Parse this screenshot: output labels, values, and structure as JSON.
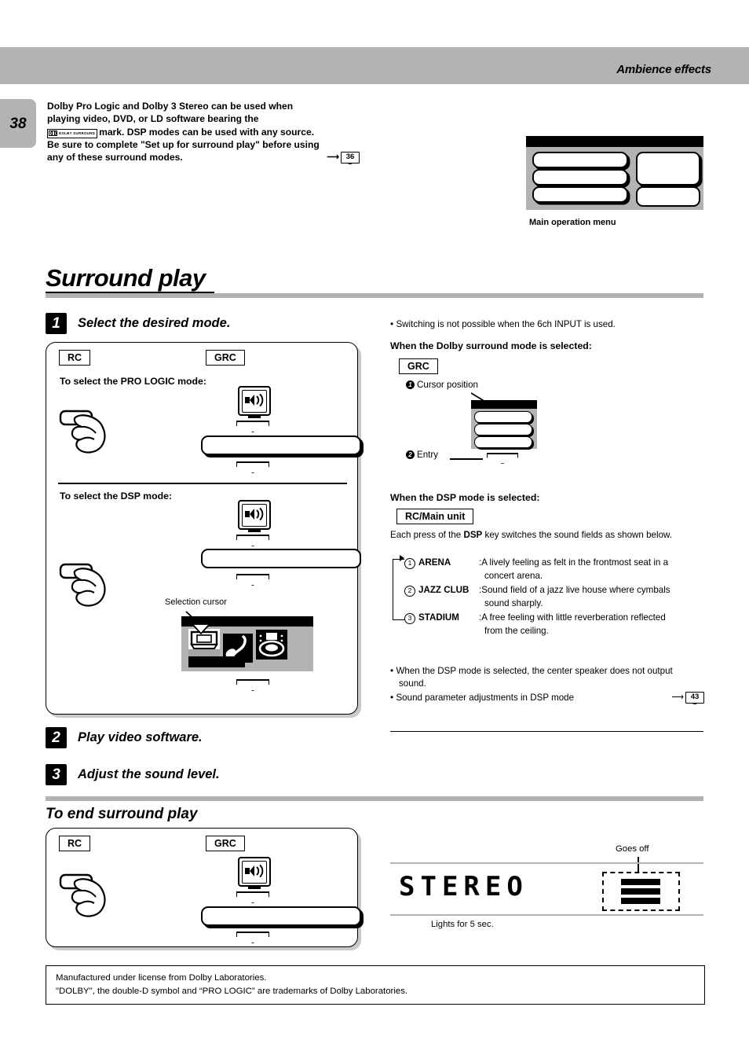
{
  "header": {
    "title": "Ambience effects",
    "page_number": "38"
  },
  "intro": {
    "line1": "Dolby Pro Logic and Dolby 3 Stereo can be used when",
    "line2": "playing video, DVD, or LD software bearing the",
    "line3_before_mark": "",
    "dolby_mark_text": "DOLBY SURROUND",
    "line3_after_mark": "mark. DSP modes can be used with any source.",
    "line4": "Be sure to complete \"Set up for surround play\" before using",
    "line5": "any of these surround modes.",
    "page_ref": "36"
  },
  "menu_illustration": {
    "caption": "Main operation menu"
  },
  "section": {
    "title": "Surround play",
    "end_title": "To end surround play"
  },
  "steps": [
    {
      "num": "1",
      "label": "Select the desired mode."
    },
    {
      "num": "2",
      "label": "Play video software."
    },
    {
      "num": "3",
      "label": "Adjust the sound level."
    }
  ],
  "panel1": {
    "tag_rc": "RC",
    "tag_grc": "GRC",
    "heading_prologic": "To select the PRO LOGIC mode:",
    "heading_dsp": "To select the DSP mode:",
    "selection_cursor_label": "Selection cursor"
  },
  "panel2": {
    "tag_rc": "RC",
    "tag_grc": "GRC"
  },
  "right_column": {
    "note_switching": "Switching is not possible when the 6ch INPUT is used.",
    "dolby_heading": "When the Dolby surround mode is selected:",
    "tag_grc": "GRC",
    "cursor_position": "Cursor position",
    "cursor_position_num": "1",
    "entry": "Entry",
    "entry_num": "2",
    "dsp_heading": "When the DSP mode is selected:",
    "tag_rc_main": "RC/Main unit",
    "dsp_intro_pre": "Each press of the ",
    "dsp_intro_key": "DSP",
    "dsp_intro_post": " key switches the sound fields as shown below.",
    "modes": [
      {
        "index": "1",
        "name": "ARENA",
        "desc_line1": ":A lively feeling as felt in the frontmost seat in a",
        "desc_line2": "concert arena."
      },
      {
        "index": "2",
        "name": "JAZZ CLUB",
        "desc_line1": ":Sound field of a jazz live house where cymbals",
        "desc_line2": "sound sharply."
      },
      {
        "index": "3",
        "name": "STADIUM",
        "desc_line1": ":A free feeling with little reverberation reflected",
        "desc_line2": "from the ceiling."
      }
    ],
    "note_center_line1": "When the DSP mode is selected, the center speaker does not output",
    "note_center_line2": "sound.",
    "note_param": "Sound parameter adjustments in DSP mode",
    "note_param_ref": "43"
  },
  "display": {
    "stereo_text": "STEREO",
    "lights_label": "Lights for 5 sec.",
    "goes_off_label": "Goes off"
  },
  "license": {
    "line1": "Manufactured under license from Dolby Laboratories.",
    "line2": "\"DOLBY\", the double-D symbol and “PRO LOGIC” are trademarks of Dolby Laboratories."
  },
  "colors": {
    "gray_band": "#b3b3b3",
    "black": "#000000",
    "shadow_gray": "#c9c9c9"
  }
}
